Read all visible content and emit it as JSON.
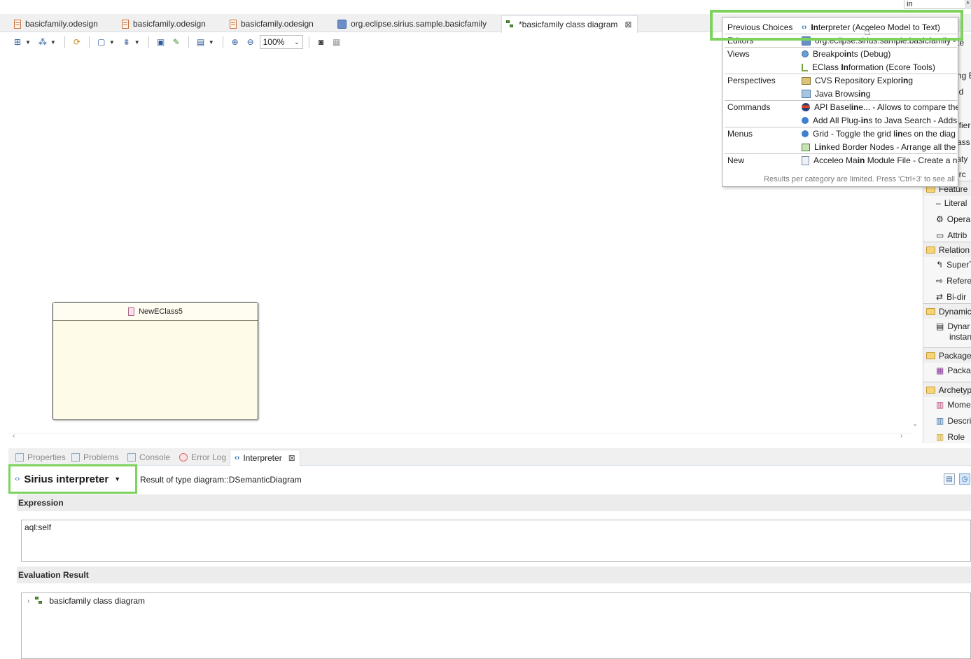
{
  "editor_tabs": [
    {
      "label": "basicfamily.odesign",
      "icon": "odesign-file-icon"
    },
    {
      "label": "basicfamily.odesign",
      "icon": "odesign-file-icon"
    },
    {
      "label": "basicfamily.odesign",
      "icon": "odesign-file-icon"
    },
    {
      "label": "org.eclipse.sirius.sample.basicfamily",
      "icon": "project-icon"
    },
    {
      "label": "*basicfamily class diagram",
      "icon": "diagram-icon",
      "active": true
    }
  ],
  "toolbar": {
    "zoom_value": "100%"
  },
  "diagram": {
    "eclass_name": "NewEClass5"
  },
  "palette": {
    "rows": [
      {
        "label": "Feature",
        "kind": "drawer"
      },
      {
        "label": "Literal",
        "kind": "item"
      },
      {
        "label": "Opera",
        "kind": "item"
      },
      {
        "label": "Attrib",
        "kind": "item"
      },
      {
        "label": "Relation",
        "kind": "drawer"
      },
      {
        "label": "SuperT",
        "kind": "item"
      },
      {
        "label": "Refere",
        "kind": "item"
      },
      {
        "label": "Bi-dir",
        "kind": "item"
      },
      {
        "label": "Dynamic",
        "kind": "drawer"
      },
      {
        "label": "Dynar",
        "kind": "item"
      },
      {
        "label": "instan",
        "kind": "item"
      },
      {
        "label": "Package",
        "kind": "drawer"
      },
      {
        "label": "Packa",
        "kind": "item"
      },
      {
        "label": "Archetyp",
        "kind": "drawer"
      },
      {
        "label": "Mome",
        "kind": "item"
      },
      {
        "label": "Descri",
        "kind": "item"
      },
      {
        "label": "Role",
        "kind": "item"
      }
    ],
    "partial_labels": [
      "te",
      "ng E",
      "ld",
      "ifier",
      "ass",
      "taty",
      "urc"
    ]
  },
  "bottom_tabs": [
    {
      "label": "Properties",
      "active": false
    },
    {
      "label": "Problems",
      "active": false
    },
    {
      "label": "Console",
      "active": false
    },
    {
      "label": "Error Log",
      "active": false
    },
    {
      "label": "Interpreter",
      "active": true
    }
  ],
  "interpreter": {
    "selector_label": "Sirius interpreter",
    "result_type": "Result of type diagram::DSemanticDiagram",
    "expression_title": "Expression",
    "expression_value": "aql:self",
    "result_title": "Evaluation Result",
    "result_tree_item": "basicfamily class diagram"
  },
  "quick_access": {
    "query": "in",
    "categories": [
      {
        "name": "Previous Choices",
        "items": [
          {
            "prefix": "",
            "bold": "In",
            "rest": "terpreter (Acceleo Model to Text)",
            "icon": "interpreter-icon"
          }
        ]
      },
      {
        "name": "Editors",
        "items": [
          {
            "prefix": "",
            "bold": "",
            "rest": "org.eclipse.sirius.sample.basicfamily - ",
            "icon": "project-icon"
          }
        ]
      },
      {
        "name": "Views",
        "items": [
          {
            "prefix": "Breakpo",
            "bold": "in",
            "rest": "ts (Debug)",
            "icon": "breakpoints-icon"
          },
          {
            "prefix": "EClass ",
            "bold": "In",
            "rest": "formation (Ecore Tools)",
            "icon": "tree-icon"
          }
        ]
      },
      {
        "name": "Perspectives",
        "items": [
          {
            "prefix": "CVS Repository Explor",
            "bold": "in",
            "rest": "g",
            "icon": "cvs-icon"
          },
          {
            "prefix": "Java Brows",
            "bold": "in",
            "rest": "g",
            "icon": "java-browsing-icon"
          }
        ]
      },
      {
        "name": "Commands",
        "items": [
          {
            "prefix": "API Basel",
            "bold": "in",
            "rest": "e... - Allows to compare the mo",
            "icon": "api-baseline-icon"
          },
          {
            "prefix": "Add All Plug-",
            "bold": "in",
            "rest": "s to Java Search - Adds",
            "icon": "blue-dot-icon"
          }
        ]
      },
      {
        "name": "Menus",
        "items": [
          {
            "prefix": "Grid - Toggle the grid l",
            "bold": "in",
            "rest": "es on the diag",
            "icon": "blue-dot-icon"
          },
          {
            "prefix": "L",
            "bold": "in",
            "rest": "ked Border Nodes - Arrange all the",
            "icon": "linked-nodes-icon"
          }
        ]
      },
      {
        "name": "New",
        "items": [
          {
            "prefix": "Acceleo Ma",
            "bold": "in",
            "rest": " Module File - Create a n",
            "icon": "acceleo-file-icon"
          }
        ]
      }
    ],
    "footer": "Results per category are limited. Press 'Ctrl+3' to see all"
  },
  "colors": {
    "highlight": "#7ed35f",
    "eclass_fill": "#fefbe8"
  }
}
